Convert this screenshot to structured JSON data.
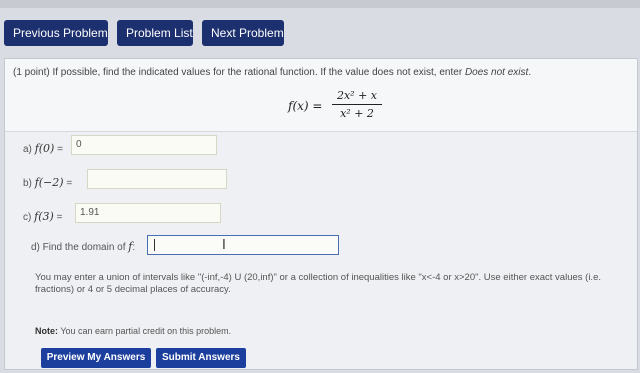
{
  "nav": {
    "previous_label": "Previous Problem",
    "list_label": "Problem List",
    "next_label": "Next Problem"
  },
  "problem": {
    "prefix": "(1 point) If possible, find the indicated values for the rational function. If the value does not exist, enter ",
    "italic_text": "Does not exist",
    "suffix": ".",
    "formula_lhs": "f(x) =",
    "formula_numerator": "2x² + x",
    "formula_denominator": "x² + 2"
  },
  "parts": {
    "a": {
      "prefix": "a)",
      "expr": "f(0)",
      "eq": "=",
      "value": "0"
    },
    "b": {
      "prefix": "b)",
      "expr": "f(−2)",
      "eq": "=",
      "value": ""
    },
    "c": {
      "prefix": "c)",
      "expr": "f(3)",
      "eq": "=",
      "value": "1.91"
    },
    "d": {
      "label": "d) Find the domain of",
      "fx": "f",
      "colon": ":",
      "value": ""
    }
  },
  "help_text": "You may enter a union of intervals like \"(-inf,-4) U (20,inf)\" or a collection of inequalities like \"x<-4 or x>20\". Use either exact values (i.e. fractions) or 4 or 5 decimal places of accuracy.",
  "note": {
    "bold": "Note:",
    "text": " You can earn partial credit on this problem."
  },
  "buttons": {
    "preview_label": "Preview My Answers",
    "submit_label": "Submit Answers"
  },
  "colors": {
    "nav_bg": "#1c2f6e",
    "button_bg": "#1c3f9e",
    "focus_border": "#4a6fb3"
  }
}
